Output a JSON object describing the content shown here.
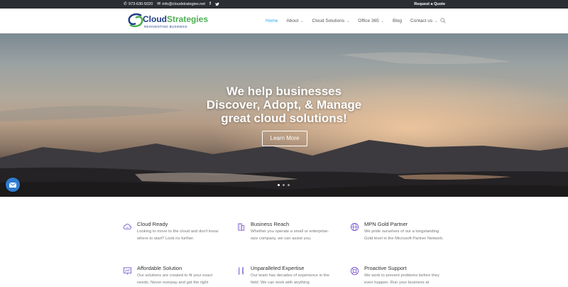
{
  "topbar": {
    "phone": "973-630-5020",
    "email": "info@cloudstrategies.net",
    "social": [
      "facebook-icon",
      "twitter-icon"
    ],
    "request_quote": "Request a Quote"
  },
  "header": {
    "logo_cloud": "Cloud",
    "logo_strategies": "Strategies",
    "logo_tagline": "REINVENTING BUSINESS",
    "nav": [
      {
        "label": "Home",
        "has_dropdown": false,
        "active": true
      },
      {
        "label": "About",
        "has_dropdown": true,
        "active": false
      },
      {
        "label": "Cloud Solutions",
        "has_dropdown": true,
        "active": false
      },
      {
        "label": "Office 365",
        "has_dropdown": true,
        "active": false
      },
      {
        "label": "Blog",
        "has_dropdown": false,
        "active": false
      },
      {
        "label": "Contact us",
        "has_dropdown": true,
        "active": false
      }
    ]
  },
  "hero": {
    "line1": "We help businesses",
    "line2": "Discover, Adopt, & Manage",
    "line3": "great cloud solutions!",
    "button": "Learn More",
    "slides": 3,
    "active_slide": 1
  },
  "features": [
    {
      "icon": "cloud-sync-icon",
      "title": "Cloud Ready",
      "desc": "Looking to move to the cloud and don't know where to start? Look no further."
    },
    {
      "icon": "building-icon",
      "title": "Business Reach",
      "desc": "Whether you operate a small or enterprise-size company, we can assist you."
    },
    {
      "icon": "globe-icon",
      "title": "MPN Gold Partner",
      "desc": "We pride ourselves of our a longstanding Gold level in the Microsoft Partner Network."
    },
    {
      "icon": "chart-board-icon",
      "title": "Affordable Solution",
      "desc": "Our solutions are created to fit your exact needs. Never overpay and get the right"
    },
    {
      "icon": "tools-icon",
      "title": "Unparalleled Expertise",
      "desc": "Our team has decades of experience in the field. We can work with anything"
    },
    {
      "icon": "lifebuoy-icon",
      "title": "Proactive Support",
      "desc": "We work to prevent problems before they even happen. Run your business at"
    }
  ],
  "colors": {
    "accent": "#2ea3f2",
    "icon_purple": "#7b5bd6",
    "topbar": "#2b2f33",
    "chat": "#2e7bcf"
  }
}
